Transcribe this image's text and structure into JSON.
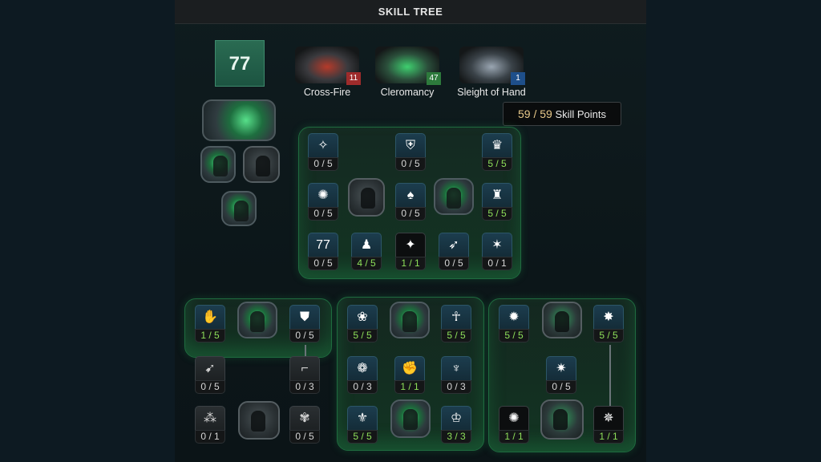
{
  "window": {
    "title": "SKILL TREE"
  },
  "hero_icon": {
    "glyph": "77"
  },
  "categories": [
    {
      "name": "Cross-Fire",
      "points": "11",
      "badge_color": "#9e2b2b",
      "art": "red-weapon"
    },
    {
      "name": "Cleromancy",
      "points": "47",
      "badge_color": "#2d7a3c",
      "art": "green-weapon"
    },
    {
      "name": "Sleight of Hand",
      "points": "1",
      "badge_color": "#1e4f8a",
      "art": "silver-weapon"
    }
  ],
  "skill_points": {
    "value": "59 / 59",
    "label": "Skill Points"
  },
  "main_tree": {
    "nodes": [
      {
        "icon": "fire-cross-icon",
        "glyph": "✧",
        "level": "0 / 5"
      },
      {
        "icon": "shield-icon",
        "glyph": "⛨",
        "level": "0 / 5"
      },
      {
        "icon": "crown-flame-icon",
        "glyph": "♛",
        "level": "5 / 5"
      },
      {
        "icon": "burst-icon",
        "glyph": "✺",
        "level": "0 / 5"
      },
      {
        "icon": "drop-icon",
        "glyph": "♠",
        "level": "0 / 5"
      },
      {
        "icon": "totem-icon",
        "glyph": "♜",
        "level": "5 / 5"
      },
      {
        "icon": "number-77-icon",
        "glyph": "77",
        "level": "0 / 5"
      },
      {
        "icon": "figure-icon",
        "glyph": "♟",
        "level": "4 / 5"
      },
      {
        "icon": "sparkle-ring-icon",
        "glyph": "✦",
        "level": "1 / 1"
      },
      {
        "icon": "dash-icon",
        "glyph": "➶",
        "level": "0 / 5"
      },
      {
        "icon": "star-icon",
        "glyph": "✶",
        "level": "0 / 1"
      }
    ]
  },
  "left_tree": {
    "nodes": [
      {
        "icon": "hand-icon",
        "glyph": "✋",
        "level": "1 / 5"
      },
      {
        "icon": "armor-icon",
        "glyph": "⛊",
        "level": "0 / 5"
      },
      {
        "icon": "speed-icon",
        "glyph": "➹",
        "level": "0 / 5"
      },
      {
        "icon": "gun-icon",
        "glyph": "⌐",
        "level": "0 / 3"
      },
      {
        "icon": "bullets-icon",
        "glyph": "⁂",
        "level": "0 / 1"
      },
      {
        "icon": "swirl-icon",
        "glyph": "✾",
        "level": "0 / 5"
      }
    ]
  },
  "mid_tree": {
    "nodes": [
      {
        "icon": "flower-icon",
        "glyph": "❀",
        "level": "5 / 5"
      },
      {
        "icon": "ankh-icon",
        "glyph": "☥",
        "level": "5 / 5"
      },
      {
        "icon": "lotus-icon",
        "glyph": "❁",
        "level": "0 / 3"
      },
      {
        "icon": "fist-icon",
        "glyph": "✊",
        "level": "1 / 1"
      },
      {
        "icon": "spirit-icon",
        "glyph": "♆",
        "level": "0 / 3"
      },
      {
        "icon": "crest-icon",
        "glyph": "⚜",
        "level": "5 / 5"
      },
      {
        "icon": "helm-icon",
        "glyph": "♔",
        "level": "3 / 3"
      }
    ]
  },
  "right_tree": {
    "nodes": [
      {
        "icon": "spark-icon",
        "glyph": "✹",
        "level": "5 / 5"
      },
      {
        "icon": "nova-icon",
        "glyph": "✸",
        "level": "5 / 5"
      },
      {
        "icon": "burst-star-icon",
        "glyph": "✷",
        "level": "0 / 5"
      },
      {
        "icon": "blast-icon",
        "glyph": "✺",
        "level": "1 / 1"
      },
      {
        "icon": "flare-icon",
        "glyph": "✵",
        "level": "1 / 1"
      }
    ]
  }
}
